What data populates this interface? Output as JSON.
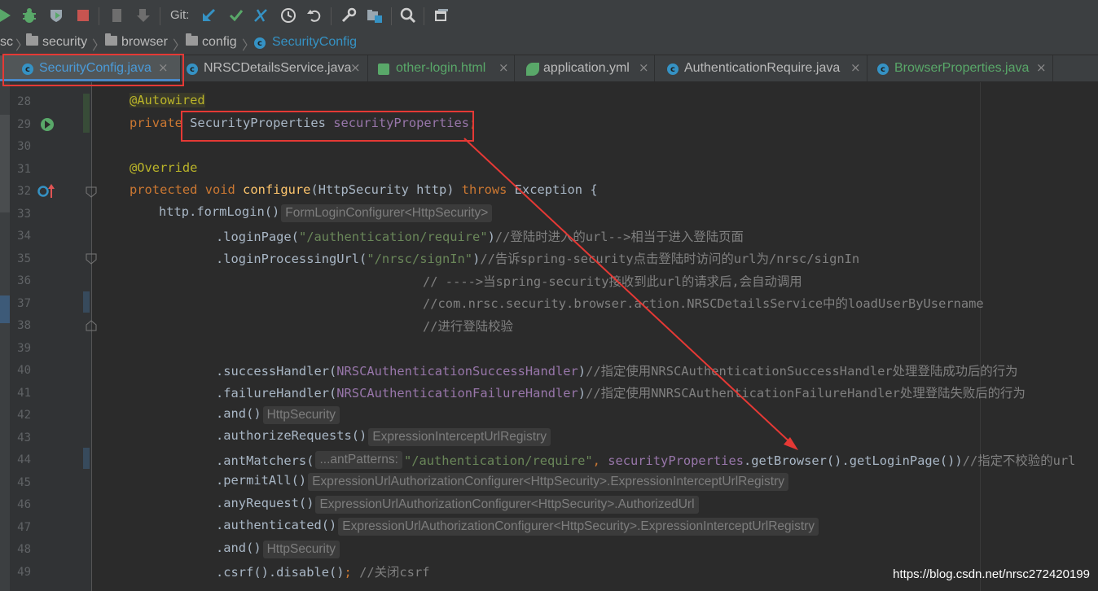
{
  "toolbar": {
    "git_label": "Git:",
    "icons": [
      "run-icon",
      "debug-icon",
      "coverage-icon",
      "stop-icon",
      "vcs-pull-icon",
      "vcs-update-icon",
      "git-update-icon",
      "git-commit-icon",
      "git-push-icon",
      "history-icon",
      "revert-icon",
      "settings-icon",
      "project-structure-icon",
      "search-icon",
      "terminal-icon"
    ]
  },
  "breadcrumb": [
    "sc",
    "security",
    "browser",
    "config",
    "SecurityConfig"
  ],
  "tabs": [
    {
      "label": "SecurityConfig.java",
      "active": true
    },
    {
      "label": "NRSCDetailsService.java",
      "active": false
    },
    {
      "label": "other-login.html",
      "active": false
    },
    {
      "label": "application.yml",
      "active": false
    },
    {
      "label": "AuthenticationRequire.java",
      "active": false
    },
    {
      "label": "BrowserProperties.java",
      "active": false
    }
  ],
  "line_numbers": [
    "28",
    "29",
    "30",
    "31",
    "32",
    "33",
    "34",
    "35",
    "36",
    "37",
    "38",
    "39",
    "40",
    "41",
    "42",
    "43",
    "44",
    "45",
    "46",
    "47",
    "48",
    "49"
  ],
  "code": {
    "l28": {
      "ann": "@Autowired"
    },
    "l29": {
      "kw": "private",
      "type": "SecurityProperties",
      "field": "securityProperties",
      "semi": ";"
    },
    "l31": {
      "ann": "@Override"
    },
    "l32": {
      "kw1": "protected",
      "kw2": "void",
      "method": "configure",
      "params": "(HttpSecurity http) ",
      "kw3": "throws",
      "rest": " Exception {"
    },
    "l33": {
      "code": "http.formLogin()",
      "hint": "FormLoginConfigurer<HttpSecurity>"
    },
    "l34": {
      "code": ".loginPage(",
      "str": "\"/authentication/require\"",
      "close": ")",
      "comment": "//登陆时进入的url-->相当于进入登陆页面"
    },
    "l35": {
      "code": ".loginProcessingUrl(",
      "str": "\"/nrsc/signIn\"",
      "close": ")",
      "comment": "//告诉spring-security点击登陆时访问的url为/nrsc/signIn"
    },
    "l36": {
      "comment": "// ---->当spring-security接收到此url的请求后,会自动调用"
    },
    "l37": {
      "comment": "//com.nrsc.security.browser.action.NRSCDetailsService中的loadUserByUsername"
    },
    "l38": {
      "comment": "//进行登陆校验"
    },
    "l40": {
      "code": ".successHandler(",
      "field": "NRSCAuthenticationSuccessHandler",
      "close": ")",
      "comment": "//指定使用NRSCAuthenticationSuccessHandler处理登陆成功后的行为"
    },
    "l41": {
      "code": ".failureHandler(",
      "field": "NRSCAuthenticationFailureHandler",
      "close": ")",
      "comment": "//指定使用NNRSCAuthenticationFailureHandler处理登陆失败后的行为"
    },
    "l42": {
      "code": ".and()",
      "hint": "HttpSecurity"
    },
    "l43": {
      "code": ".authorizeRequests()",
      "hint": "ExpressionInterceptUrlRegistry"
    },
    "l44": {
      "code": ".antMatchers(",
      "hint": "...antPatterns:",
      "str": "\"/authentication/require\"",
      "comma": ",",
      "field": "securityProperties",
      "rest": ".getBrowser().getLoginPage())",
      "comment": "//指定不校验的url"
    },
    "l45": {
      "code": ".permitAll()",
      "hint": "ExpressionUrlAuthorizationConfigurer<HttpSecurity>.ExpressionInterceptUrlRegistry"
    },
    "l46": {
      "code": ".anyRequest()",
      "hint": "ExpressionUrlAuthorizationConfigurer<HttpSecurity>.AuthorizedUrl"
    },
    "l47": {
      "code": ".authenticated()",
      "hint": "ExpressionUrlAuthorizationConfigurer<HttpSecurity>.ExpressionInterceptUrlRegistry"
    },
    "l48": {
      "code": ".and()",
      "hint": "HttpSecurity"
    },
    "l49": {
      "code": ".csrf().disable()",
      "semi": ";",
      "comment": "//关闭csrf"
    }
  },
  "watermark": "https://blog.csdn.net/nrsc272420199",
  "colors": {
    "annotation_red": "#e53935",
    "accent_blue": "#4a88c7",
    "background": "#2b2b2b"
  }
}
